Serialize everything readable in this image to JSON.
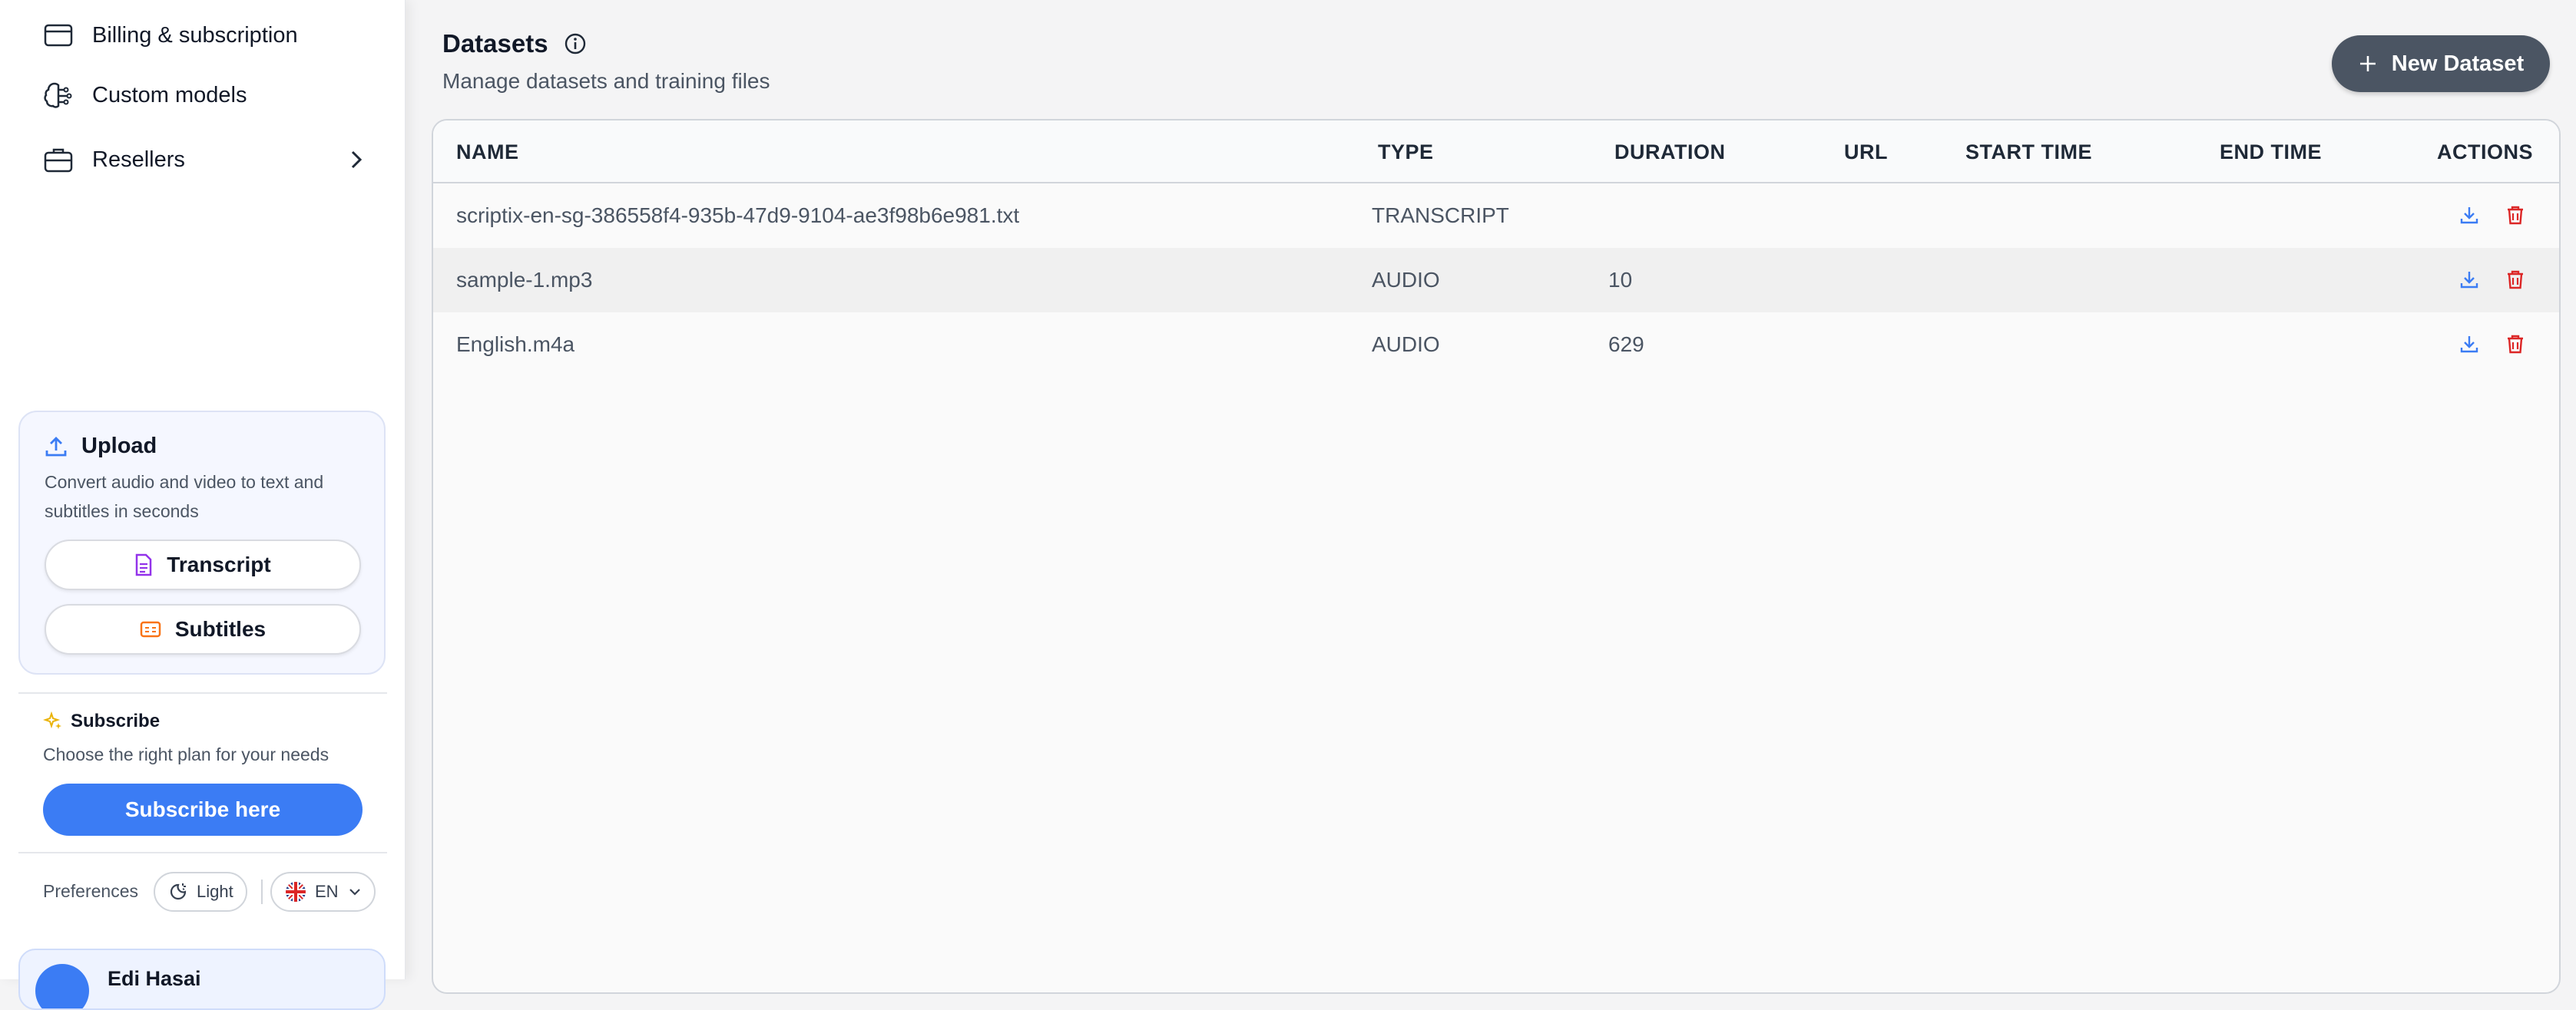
{
  "sidebar": {
    "nav": [
      {
        "label": "Billing & subscription",
        "icon": "credit-card-icon"
      },
      {
        "label": "Custom models",
        "icon": "brain-icon"
      },
      {
        "label": "Resellers",
        "icon": "briefcase-icon"
      }
    ],
    "upload": {
      "title": "Upload",
      "description": "Convert audio and video to text and subtitles in seconds",
      "transcript_label": "Transcript",
      "subtitles_label": "Subtitles"
    },
    "subscribe": {
      "title": "Subscribe",
      "description": "Choose the right plan for your needs",
      "button_label": "Subscribe here"
    },
    "preferences": {
      "label": "Preferences",
      "theme": "Light",
      "language": "EN"
    },
    "user": {
      "name": "Edi Hasai"
    }
  },
  "header": {
    "title": "Datasets",
    "subtitle": "Manage datasets and training files",
    "new_button_label": "New Dataset"
  },
  "table": {
    "columns": [
      "NAME",
      "TYPE",
      "DURATION",
      "URL",
      "START TIME",
      "END TIME",
      "ACTIONS"
    ],
    "rows": [
      {
        "name": "scriptix-en-sg-386558f4-935b-47d9-9104-ae3f98b6e981.txt",
        "type": "TRANSCRIPT",
        "duration": "",
        "url": "",
        "start_time": "",
        "end_time": ""
      },
      {
        "name": "sample-1.mp3",
        "type": "AUDIO",
        "duration": "10",
        "url": "",
        "start_time": "",
        "end_time": ""
      },
      {
        "name": "English.m4a",
        "type": "AUDIO",
        "duration": "629",
        "url": "",
        "start_time": "",
        "end_time": ""
      }
    ]
  },
  "colors": {
    "primary": "#3b7cf4",
    "dark_button": "#4b5563",
    "delete": "#dc2626",
    "download": "#3b7cf4",
    "transcript_icon": "#9333ea",
    "subtitles_icon": "#f97316",
    "subscribe_icon": "#eab308"
  }
}
